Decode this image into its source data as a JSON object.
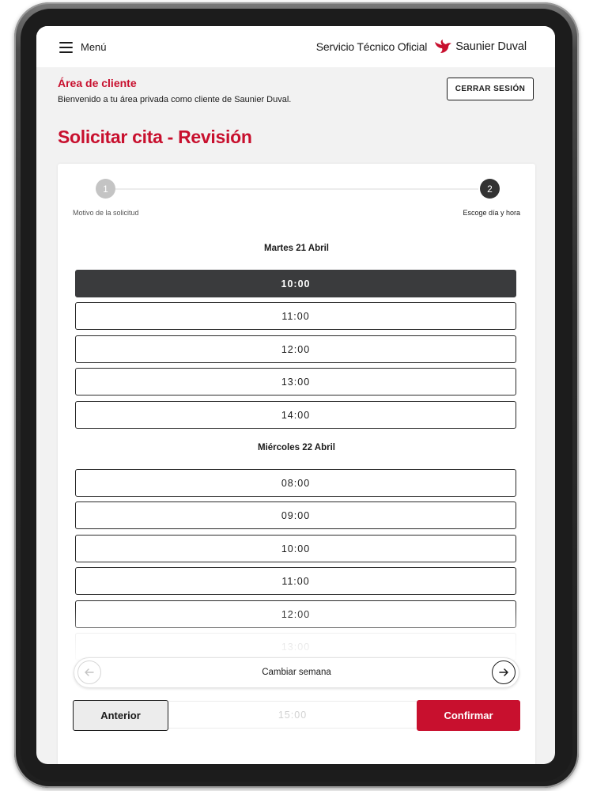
{
  "header": {
    "menu_label": "Menú",
    "service_text": "Servicio Técnico Oficial",
    "brand_name": "Saunier Duval",
    "brand_color": "#c8102e"
  },
  "client_area": {
    "title": "Área de cliente",
    "welcome": "Bienvenido a tu área privada como cliente de Saunier Duval.",
    "logout_label": "CERRAR SESIÓN"
  },
  "page": {
    "title": "Solicitar cita - Revisión"
  },
  "steps": [
    {
      "number": "1",
      "label": "Motivo de la solicitud",
      "state": "done"
    },
    {
      "number": "2",
      "label": "Escoge día y hora",
      "state": "active"
    }
  ],
  "days": [
    {
      "label": "Martes 21 Abril",
      "slots": [
        "10:00",
        "11:00",
        "12:00",
        "13:00",
        "14:00"
      ],
      "selected": "10:00"
    },
    {
      "label": "Miércoles 22 Abril",
      "slots": [
        "08:00",
        "09:00",
        "10:00",
        "11:00",
        "12:00",
        "13:00",
        "15:00"
      ]
    }
  ],
  "week_nav": {
    "label": "Cambiar semana",
    "prev_icon": "arrow-left-icon",
    "next_icon": "arrow-right-icon"
  },
  "actions": {
    "previous_label": "Anterior",
    "confirm_label": "Confirmar"
  },
  "colors": {
    "accent": "#c8102e",
    "selected_slot": "#3a3b3d",
    "background": "#f2f2f2"
  }
}
